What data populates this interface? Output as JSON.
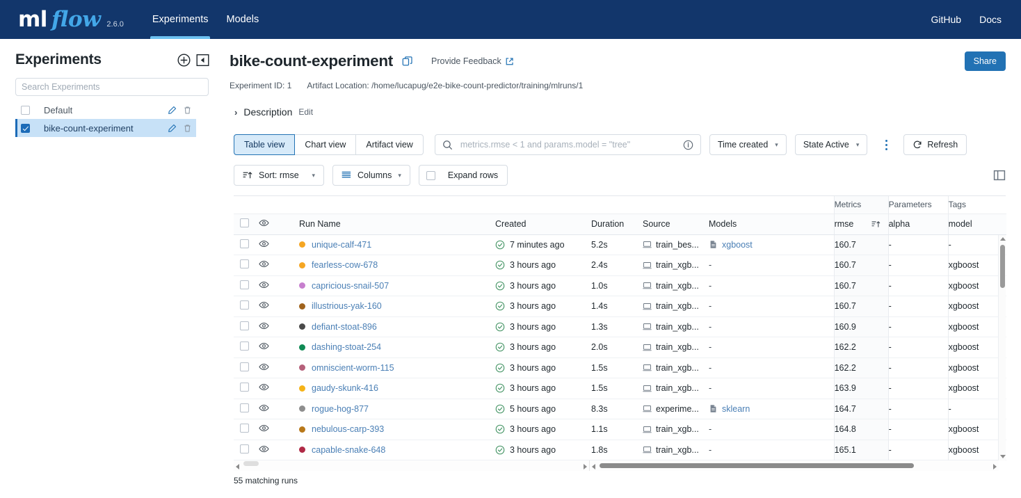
{
  "header": {
    "brand_ml": "ml",
    "brand_flow": "flow",
    "version": "2.6.0",
    "nav": [
      {
        "label": "Experiments",
        "active": true
      },
      {
        "label": "Models",
        "active": false
      }
    ],
    "right_links": [
      {
        "label": "GitHub"
      },
      {
        "label": "Docs"
      }
    ],
    "brand_color": "#43a7e8",
    "bar_color": "#12366b"
  },
  "sidebar": {
    "title": "Experiments",
    "new_experiment_icon": "plus-circle-icon",
    "collapse_icon": "collapse-panel-icon",
    "search_placeholder": "Search Experiments",
    "search_value": "",
    "experiments": [
      {
        "name": "Default",
        "selected": false
      },
      {
        "name": "bike-count-experiment",
        "selected": true
      }
    ],
    "row_edit_icon": "pencil-icon",
    "row_delete_icon": "trash-icon"
  },
  "experiment": {
    "title": "bike-count-experiment",
    "copy_icon": "copy-icon",
    "feedback_label": "Provide Feedback",
    "feedback_icon": "external-link-icon",
    "share_label": "Share",
    "experiment_id_label": "Experiment ID: 1",
    "artifact_location_label": "Artifact Location: /home/lucapug/e2e-bike-count-predictor/training/mlruns/1",
    "description_label": "Description",
    "description_edit_label": "Edit",
    "description_chevron": "chevron-right-icon"
  },
  "toolbar": {
    "views": [
      {
        "label": "Table view",
        "active": true
      },
      {
        "label": "Chart view",
        "active": false
      },
      {
        "label": "Artifact view",
        "active": false
      }
    ],
    "search_placeholder": "metrics.rmse < 1 and params.model = \"tree\"",
    "search_value": "",
    "search_icon": "search-icon",
    "info_icon": "info-circle-icon",
    "time_created_label": "Time created",
    "state_label": "State Active",
    "kebab_icon": "more-vertical-icon",
    "refresh_label": "Refresh",
    "refresh_icon": "refresh-icon",
    "sort_label": "Sort: rmse",
    "sort_icon": "sort-ascending-icon",
    "columns_label": "Columns",
    "columns_icon": "columns-list-icon",
    "expand_rows_label": "Expand rows",
    "expand_rows_checked": false,
    "panel_toggle_icon": "side-panel-icon"
  },
  "table": {
    "group_headers": {
      "metrics": "Metrics",
      "parameters": "Parameters",
      "tags": "Tags"
    },
    "columns": {
      "select": "",
      "visibility_icon": "eye-icon",
      "run_name": "Run Name",
      "created": "Created",
      "duration": "Duration",
      "source": "Source",
      "models": "Models",
      "rmse": "rmse",
      "rmse_sort_icon": "sort-ascending-icon",
      "alpha": "alpha",
      "model": "model"
    },
    "rows": [
      {
        "dot": "#f5a623",
        "run_name": "unique-calf-471",
        "created": "7 minutes ago",
        "duration": "5.2s",
        "source": "train_bes...",
        "model_link": "xgboost",
        "rmse": "160.7",
        "alpha": "-",
        "model": "-"
      },
      {
        "dot": "#f5a623",
        "run_name": "fearless-cow-678",
        "created": "3 hours ago",
        "duration": "2.4s",
        "source": "train_xgb...",
        "model_link": "",
        "rmse": "160.7",
        "alpha": "-",
        "model": "xgboost"
      },
      {
        "dot": "#c77fce",
        "run_name": "capricious-snail-507",
        "created": "3 hours ago",
        "duration": "1.0s",
        "source": "train_xgb...",
        "model_link": "",
        "rmse": "160.7",
        "alpha": "-",
        "model": "xgboost"
      },
      {
        "dot": "#a0631c",
        "run_name": "illustrious-yak-160",
        "created": "3 hours ago",
        "duration": "1.4s",
        "source": "train_xgb...",
        "model_link": "",
        "rmse": "160.7",
        "alpha": "-",
        "model": "xgboost"
      },
      {
        "dot": "#4a4a4a",
        "run_name": "defiant-stoat-896",
        "created": "3 hours ago",
        "duration": "1.3s",
        "source": "train_xgb...",
        "model_link": "",
        "rmse": "160.9",
        "alpha": "-",
        "model": "xgboost"
      },
      {
        "dot": "#0f8a54",
        "run_name": "dashing-stoat-254",
        "created": "3 hours ago",
        "duration": "2.0s",
        "source": "train_xgb...",
        "model_link": "",
        "rmse": "162.2",
        "alpha": "-",
        "model": "xgboost"
      },
      {
        "dot": "#b5607a",
        "run_name": "omniscient-worm-115",
        "created": "3 hours ago",
        "duration": "1.5s",
        "source": "train_xgb...",
        "model_link": "",
        "rmse": "162.2",
        "alpha": "-",
        "model": "xgboost"
      },
      {
        "dot": "#f5b318",
        "run_name": "gaudy-skunk-416",
        "created": "3 hours ago",
        "duration": "1.5s",
        "source": "train_xgb...",
        "model_link": "",
        "rmse": "163.9",
        "alpha": "-",
        "model": "xgboost"
      },
      {
        "dot": "#8e8e8e",
        "run_name": "rogue-hog-877",
        "created": "5 hours ago",
        "duration": "8.3s",
        "source": "experime...",
        "model_link": "sklearn",
        "rmse": "164.7",
        "alpha": "-",
        "model": "-"
      },
      {
        "dot": "#b8781a",
        "run_name": "nebulous-carp-393",
        "created": "3 hours ago",
        "duration": "1.1s",
        "source": "train_xgb...",
        "model_link": "",
        "rmse": "164.8",
        "alpha": "-",
        "model": "xgboost"
      },
      {
        "dot": "#b02a46",
        "run_name": "capable-snake-648",
        "created": "3 hours ago",
        "duration": "1.8s",
        "source": "train_xgb...",
        "model_link": "",
        "rmse": "165.1",
        "alpha": "-",
        "model": "xgboost"
      }
    ],
    "status_icon": "check-circle-icon",
    "source_icon": "notebook-icon",
    "model_icon": "model-file-icon",
    "matching_runs_label": "55 matching runs"
  }
}
